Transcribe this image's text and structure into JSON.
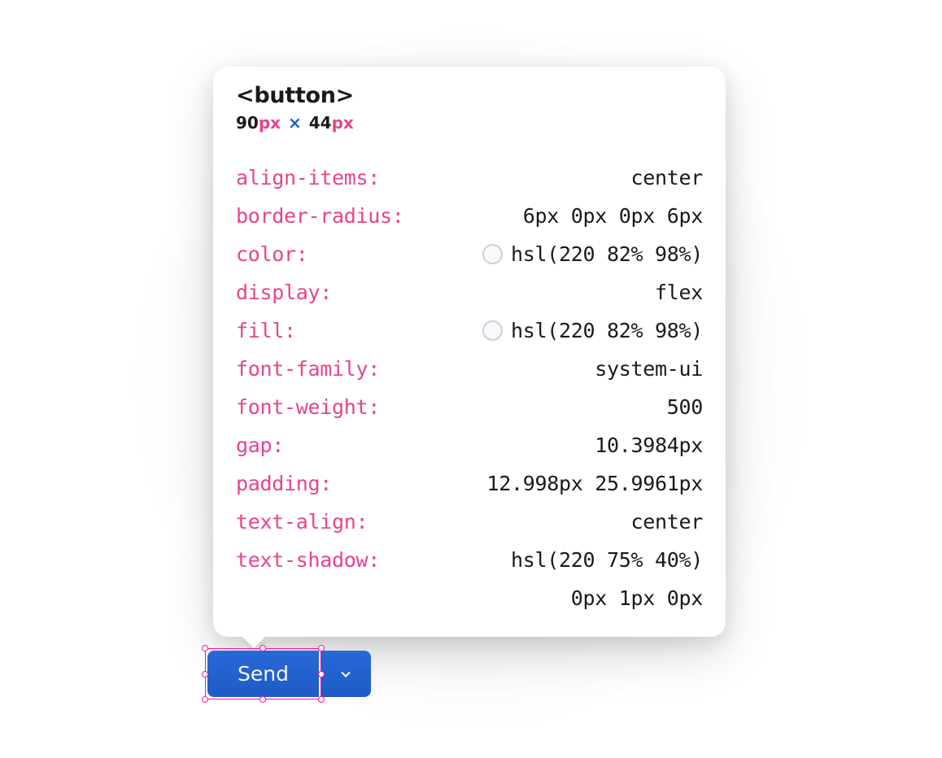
{
  "tooltip": {
    "element_tag": "<button>",
    "dimensions": {
      "width": "90",
      "width_unit": "px",
      "separator": "×",
      "height": "44",
      "height_unit": "px"
    },
    "properties": [
      {
        "name": "align-items:",
        "value": "center",
        "has_swatch": false
      },
      {
        "name": "border-radius:",
        "value": "6px 0px 0px 6px",
        "has_swatch": false
      },
      {
        "name": "color:",
        "value": "hsl(220 82% 98%)",
        "has_swatch": true
      },
      {
        "name": "display:",
        "value": "flex",
        "has_swatch": false
      },
      {
        "name": "fill:",
        "value": "hsl(220 82% 98%)",
        "has_swatch": true
      },
      {
        "name": "font-family:",
        "value": "system-ui",
        "has_swatch": false
      },
      {
        "name": "font-weight:",
        "value": "500",
        "has_swatch": false
      },
      {
        "name": "gap:",
        "value": "10.3984px",
        "has_swatch": false
      },
      {
        "name": "padding:",
        "value": "12.998px 25.9961px",
        "has_swatch": false
      },
      {
        "name": "text-align:",
        "value": "center",
        "has_swatch": false
      },
      {
        "name": "text-shadow:",
        "value": "hsl(220 75% 40%)",
        "value2": "0px 1px 0px",
        "has_swatch": false
      }
    ]
  },
  "button": {
    "label": "Send"
  }
}
